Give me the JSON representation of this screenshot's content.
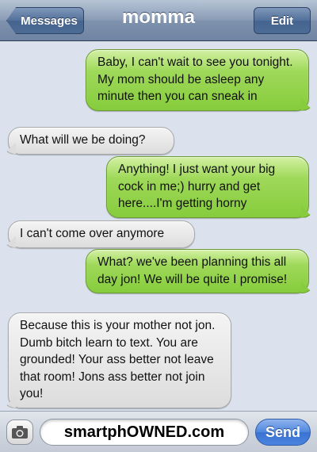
{
  "navbar": {
    "back_label": "Messages",
    "title": "momma",
    "edit_label": "Edit"
  },
  "messages": [
    {
      "direction": "outgoing",
      "text": "Baby, I can't wait to see you tonight. My mom should be asleep any minute then you can sneak in"
    },
    {
      "direction": "incoming",
      "text": "What will we be doing?"
    },
    {
      "direction": "outgoing",
      "text": "Anything! I just want your big cock in me;) hurry and get here....I'm getting horny"
    },
    {
      "direction": "incoming",
      "text": "I can't come over anymore"
    },
    {
      "direction": "outgoing",
      "text": "What? we've been planning this all day jon! We will be quite I promise!"
    },
    {
      "direction": "incoming",
      "text": "Because this is your mother not jon. Dumb bitch learn to text. You are grounded! Your ass better not leave that room! Jons ass better not join you!"
    }
  ],
  "input": {
    "value": "smartphOWNED.com",
    "send_label": "Send",
    "camera_icon": "camera-icon"
  },
  "colors": {
    "outgoing_bubble": "#86cc3c",
    "incoming_bubble": "#e6e6e6",
    "background": "#dbe2ed",
    "navbar": "#8b9db6",
    "send_button": "#4a82df"
  }
}
